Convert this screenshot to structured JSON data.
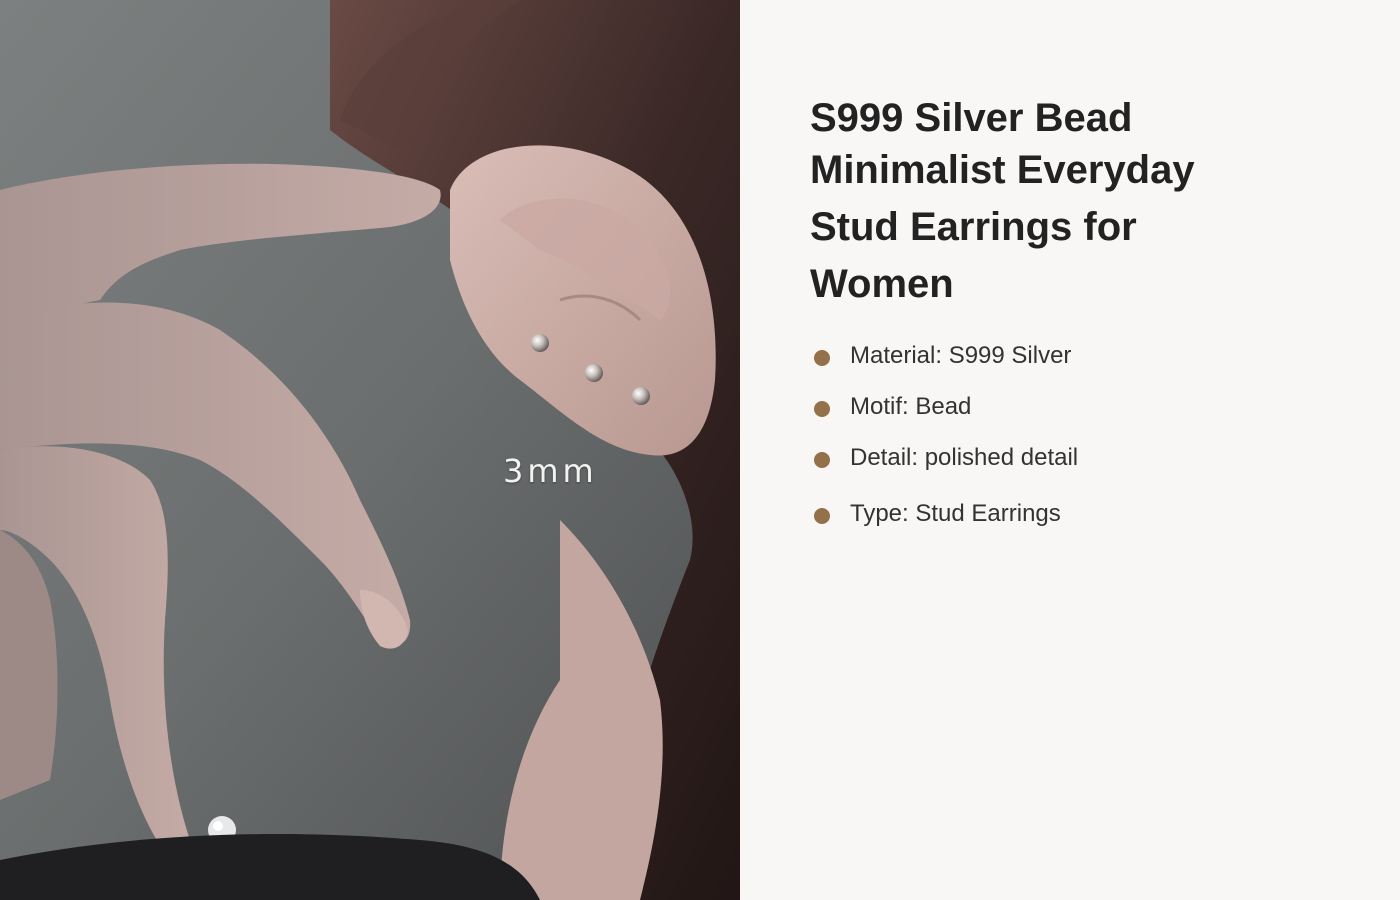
{
  "image": {
    "size_label": "3mm"
  },
  "product": {
    "title_lines": [
      "S999 Silver Bead",
      "Minimalist Everyday",
      "Stud Earrings for",
      "Women"
    ],
    "features": [
      "Material: S999 Silver",
      "Motif: Bead",
      "Detail: polished detail",
      "Type: Stud Earrings"
    ]
  },
  "colors": {
    "background": "#f8f7f5",
    "title": "#222222",
    "bullet": "#94714a",
    "feature_text": "#333333"
  }
}
